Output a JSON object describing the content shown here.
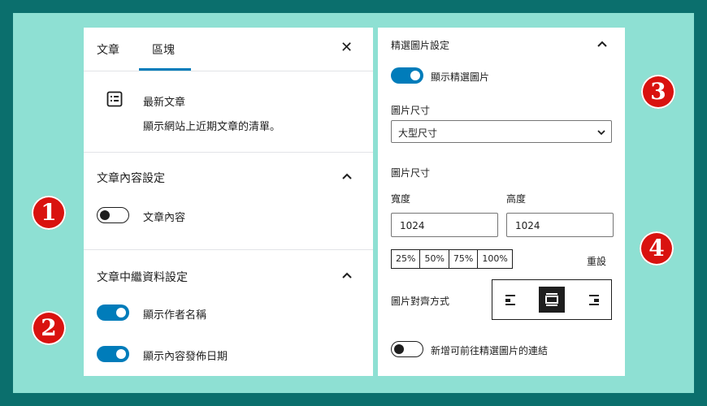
{
  "left_panel": {
    "tabs": [
      {
        "label": "文章"
      },
      {
        "label": "區塊"
      }
    ],
    "close_label": "✕",
    "block": {
      "title": "最新文章",
      "description": "顯示網站上近期文章的清單。"
    },
    "content_settings": {
      "title": "文章內容設定",
      "toggle": {
        "label": "文章內容",
        "state": "off"
      }
    },
    "meta_settings": {
      "title": "文章中繼資料設定",
      "toggles": [
        {
          "label": "顯示作者名稱",
          "state": "on"
        },
        {
          "label": "顯示內容發佈日期",
          "state": "on"
        }
      ]
    }
  },
  "right_panel": {
    "featured_title": "精選圖片設定",
    "show_featured": {
      "label": "顯示精選圖片",
      "state": "on"
    },
    "image_size_label": "圖片尺寸",
    "image_size_value": "大型尺寸",
    "image_dims_label": "圖片尺寸",
    "width_label": "寬度",
    "height_label": "高度",
    "width_value": "1024",
    "height_value": "1024",
    "percent_buttons": [
      "25%",
      "50%",
      "75%",
      "100%"
    ],
    "reset_label": "重設",
    "alignment_label": "圖片對齊方式",
    "alignment_selected": "center",
    "link_toggle": {
      "label": "新增可前往精選圖片的連結",
      "state": "off"
    }
  },
  "badges": [
    "1",
    "2",
    "3",
    "4"
  ],
  "colors": {
    "accent": "#007cba",
    "background": "#0b6f6d",
    "frame": "#8ee0d3",
    "badge": "#d9120f"
  }
}
